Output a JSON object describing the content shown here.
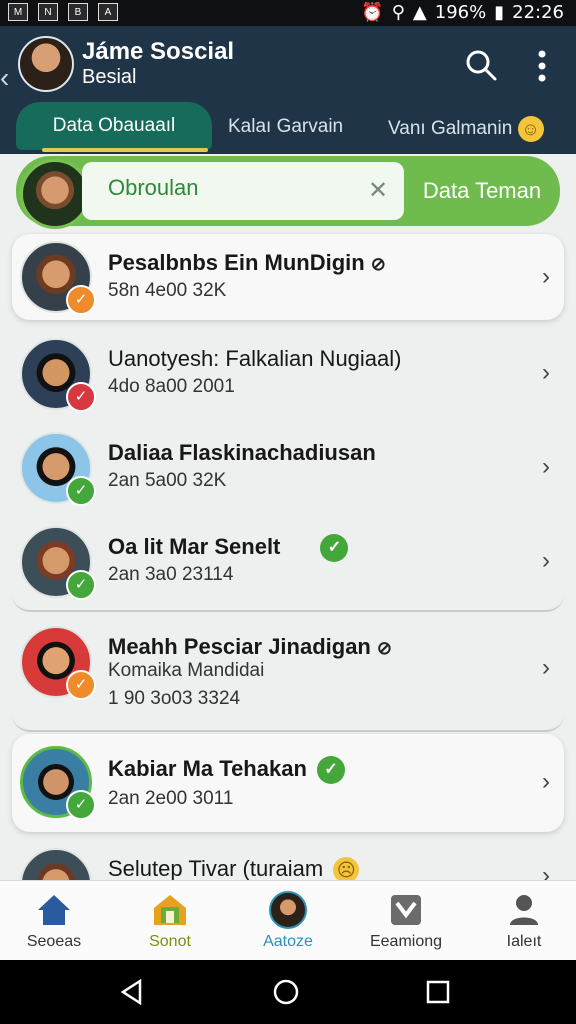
{
  "status": {
    "battery_percent": "196%",
    "time": "22:26"
  },
  "appbar": {
    "title": "Jáme Soscial",
    "subtitle": "Besial"
  },
  "tabs": [
    {
      "label": "Data Obauaaıl"
    },
    {
      "label": "Kalaı Garvain"
    },
    {
      "label": "Vanı Galmanin"
    }
  ],
  "search": {
    "value": "Obroulan",
    "button_label": "Data Teman"
  },
  "contacts": [
    {
      "name": "Pesalbnbs Ein MunDigin",
      "line1": "58n 4e00 32K",
      "line2": "",
      "status": "orange",
      "highlight": true
    },
    {
      "name": "Uanotyesh: Falkalian Nugiaal)",
      "line1": "4do 8a00 2001",
      "line2": "",
      "status": "red",
      "highlight": false
    },
    {
      "name": "Daliaa Flaskinachadiusan",
      "line1": "2an 5a00 32K",
      "line2": "",
      "status": "green",
      "highlight": false
    },
    {
      "name": "Oa lit Mar Senelt",
      "line1": "2an 3a0 23114",
      "line2": "",
      "status": "green",
      "highlight": false
    },
    {
      "name": "Meahh Pesciar Jinadigan",
      "line1": "Komaika Mandidai",
      "line2": "1 90 3o03 3324",
      "status": "orange",
      "highlight": false
    },
    {
      "name": "Kabiar Ma Tehakan",
      "line1": "2an 2e00 3011",
      "line2": "",
      "status": "green",
      "highlight": true
    },
    {
      "name": "Selutep Tivar (turaiam",
      "line1": "",
      "line2": "",
      "status": "green",
      "highlight": false
    }
  ],
  "bottom_nav": [
    {
      "label": "Seoeas"
    },
    {
      "label": "Sonot"
    },
    {
      "label": "Aatoze"
    },
    {
      "label": "Eeamiong"
    },
    {
      "label": "Ialeıt"
    }
  ]
}
